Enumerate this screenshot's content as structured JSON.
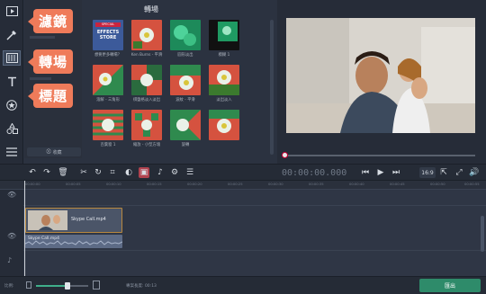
{
  "callouts": {
    "filters": "濾鏡",
    "transitions": "轉場",
    "titles": "標題"
  },
  "categories": {
    "footer_label": "收藏"
  },
  "transitions_panel": {
    "title": "轉場",
    "tiles": [
      {
        "label": "想要更多轉場？",
        "special": "EFFECTS STORE",
        "special_top": "SPECIAL"
      },
      {
        "label": "Ken Burns - 平滑"
      },
      {
        "label": "圓形淡出"
      },
      {
        "label": "模糊 1"
      },
      {
        "label": "溶解 - 三角形"
      },
      {
        "label": "棋盤格淡入淡出"
      },
      {
        "label": "波紋 - 平滑"
      },
      {
        "label": "淡出淡入"
      },
      {
        "label": "百葉窗 1"
      },
      {
        "label": "縮放 - 小型方塊"
      },
      {
        "label": "旋轉"
      },
      {
        "label": ""
      }
    ]
  },
  "toolbar": {
    "timecode": "00:00:00.000",
    "aspect_ratio": "16:9",
    "tools": [
      "undo-icon",
      "redo-icon",
      "trash-icon",
      "cut-icon",
      "rotate-icon",
      "crop-icon",
      "color-icon",
      "media-icon",
      "audio-icon",
      "settings-icon",
      "equalizer-icon"
    ]
  },
  "ruler": {
    "ticks": [
      "00:00:00",
      "00:00:05",
      "00:00:10",
      "00:00:15",
      "00:00:20",
      "00:00:25",
      "00:00:30",
      "00:00:35",
      "00:00:40",
      "00:00:45",
      "00:00:50",
      "00:00:55"
    ]
  },
  "timeline": {
    "video_clip": "Skype Call.mp4",
    "audio_clip": "Skype Call.mp4"
  },
  "bottom": {
    "zoom_label": "比例:",
    "duration_label": "專案長度: 00:13",
    "export_label": "匯出",
    "zoom_fraction": 0.6
  }
}
